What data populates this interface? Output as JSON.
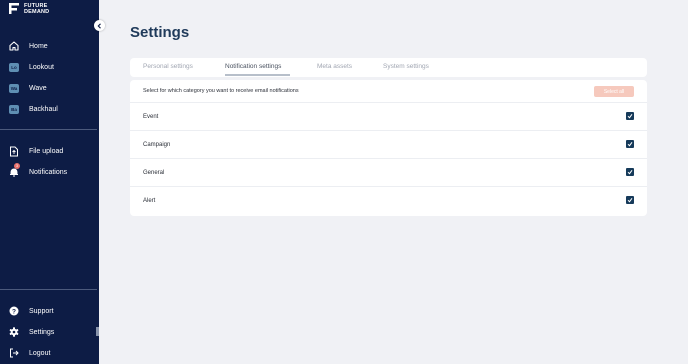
{
  "brand": {
    "line1": "FUTURE",
    "line2": "DEMAND"
  },
  "sidebar": {
    "main_items": [
      {
        "label": "Home",
        "icon": "home-icon"
      },
      {
        "label": "Lookout",
        "abbr": "Lo"
      },
      {
        "label": "Wave",
        "abbr": "Wa"
      },
      {
        "label": "Backhaul",
        "abbr": "Ba"
      }
    ],
    "tool_items": [
      {
        "label": "File upload",
        "icon": "file-upload-icon"
      },
      {
        "label": "Notifications",
        "icon": "bell-icon",
        "badge": "3"
      }
    ],
    "bottom_items": [
      {
        "label": "Support",
        "icon": "help-icon"
      },
      {
        "label": "Settings",
        "icon": "gear-icon"
      },
      {
        "label": "Logout",
        "icon": "logout-icon"
      }
    ]
  },
  "page": {
    "title": "Settings"
  },
  "tabs": [
    {
      "label": "Personal settings",
      "active": false
    },
    {
      "label": "Notification settings",
      "active": true
    },
    {
      "label": "Meta assets",
      "active": false
    },
    {
      "label": "System settings",
      "active": false
    }
  ],
  "notifications": {
    "header": "Select for which category you want to receive email notifications",
    "select_all_label": "Select all",
    "categories": [
      {
        "label": "Event",
        "checked": true
      },
      {
        "label": "Campaign",
        "checked": true
      },
      {
        "label": "General",
        "checked": true
      },
      {
        "label": "Alert",
        "checked": true
      }
    ]
  },
  "colors": {
    "sidebar_bg": "#0d1c45",
    "page_bg": "#f0f1f5",
    "title": "#1f3a5a",
    "checkbox": "#163a5a",
    "select_all_bg": "#f6c9bd",
    "badge": "#e7706c"
  }
}
